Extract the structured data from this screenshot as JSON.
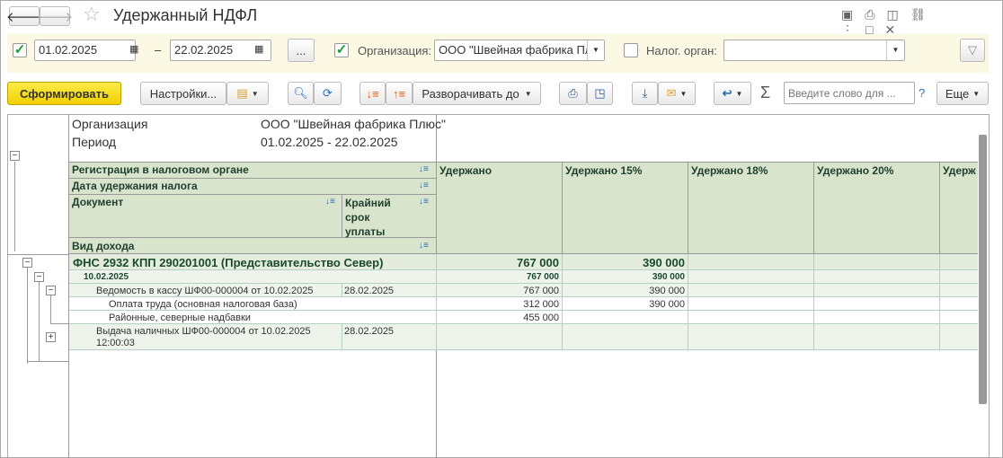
{
  "title": "Удержанный НДФЛ",
  "filters": {
    "period_enabled": true,
    "date_from": "01.02.2025",
    "date_sep": "–",
    "date_to": "22.02.2025",
    "more": "...",
    "org_enabled": true,
    "org_label": "Организация:",
    "org_value": "ООО \"Швейная фабрика Плюс\"",
    "tax_enabled": false,
    "tax_label": "Налог. орган:",
    "tax_value": ""
  },
  "toolbar": {
    "generate": "Сформировать",
    "settings": "Настройки...",
    "expand": "Разворачивать до",
    "search_placeholder": "Введите слово для ...",
    "help": "?",
    "more": "Еще"
  },
  "report": {
    "org_label": "Организация",
    "org_value": "ООО \"Швейная фабрика Плюс\"",
    "period_label": "Период",
    "period_value": "01.02.2025 - 22.02.2025",
    "headers": {
      "reg": "Регистрация в налоговом органе",
      "date": "Дата удержания налога",
      "doc": "Документ",
      "deadline": "Крайний срок уплаты",
      "income": "Вид дохода",
      "cols": [
        "Удержано",
        "Удержано 15%",
        "Удержано 18%",
        "Удержано 20%",
        "Удерж"
      ]
    },
    "rows": [
      {
        "label": "ФНС 2932 КПП 290201001 (Представительство Север)",
        "deadline": "",
        "vals": [
          "767 000",
          "390 000",
          "",
          "",
          ""
        ]
      },
      {
        "label": "10.02.2025",
        "deadline": "",
        "vals": [
          "767 000",
          "390 000",
          "",
          "",
          ""
        ]
      },
      {
        "label": "Ведомость в кассу ШФ00-000004 от 10.02.2025",
        "deadline": "28.02.2025",
        "vals": [
          "767 000",
          "390 000",
          "",
          "",
          ""
        ]
      },
      {
        "label": "Оплата труда (основная налоговая база)",
        "deadline": "",
        "vals": [
          "312 000",
          "390 000",
          "",
          "",
          ""
        ]
      },
      {
        "label": "Районные, северные надбавки",
        "deadline": "",
        "vals": [
          "455 000",
          "",
          "",
          "",
          ""
        ]
      },
      {
        "label": "Выдача наличных ШФ00-000004 от 10.02.2025 12:00:03",
        "deadline": "28.02.2025",
        "vals": [
          "",
          "",
          "",
          "",
          ""
        ]
      }
    ]
  }
}
